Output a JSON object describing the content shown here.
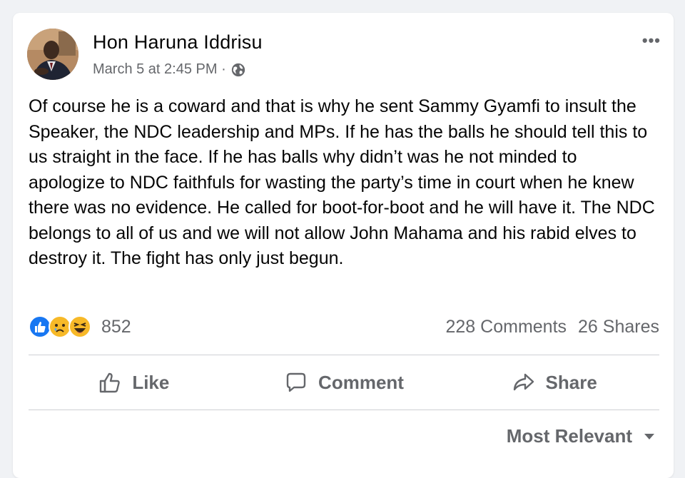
{
  "post": {
    "author": "Hon Haruna Iddrisu",
    "timestamp": "March 5 at  2:45 PM ·",
    "privacy_icon": "globe-icon",
    "more_label": "•••",
    "text": "Of course he is a coward and that is why he sent Sammy Gyamfi to insult the Speaker, the NDC leadership and MPs. If he has the balls he should tell this to us straight in the face. If he has balls why didn’t was he not minded to apologize to NDC faithfuls for wasting the party’s time in court when he knew there was no evidence. He called for boot-for-boot and he will have it. The NDC belongs to all of us and we will not allow John Mahama and his rabid elves to destroy it. The fight has only just begun."
  },
  "reactions": {
    "icons": [
      "like-icon",
      "sad-icon",
      "haha-icon"
    ],
    "count": "852"
  },
  "stats": {
    "comments": "228 Comments",
    "shares": "26 Shares"
  },
  "actions": {
    "like_label": "Like",
    "comment_label": "Comment",
    "share_label": "Share"
  },
  "comments_sort": {
    "label": "Most Relevant"
  },
  "colors": {
    "like_blue": "#1877f2",
    "secondary_text": "#65676b",
    "divider": "#ced0d4",
    "emoji_yellow": "#f7b928"
  }
}
